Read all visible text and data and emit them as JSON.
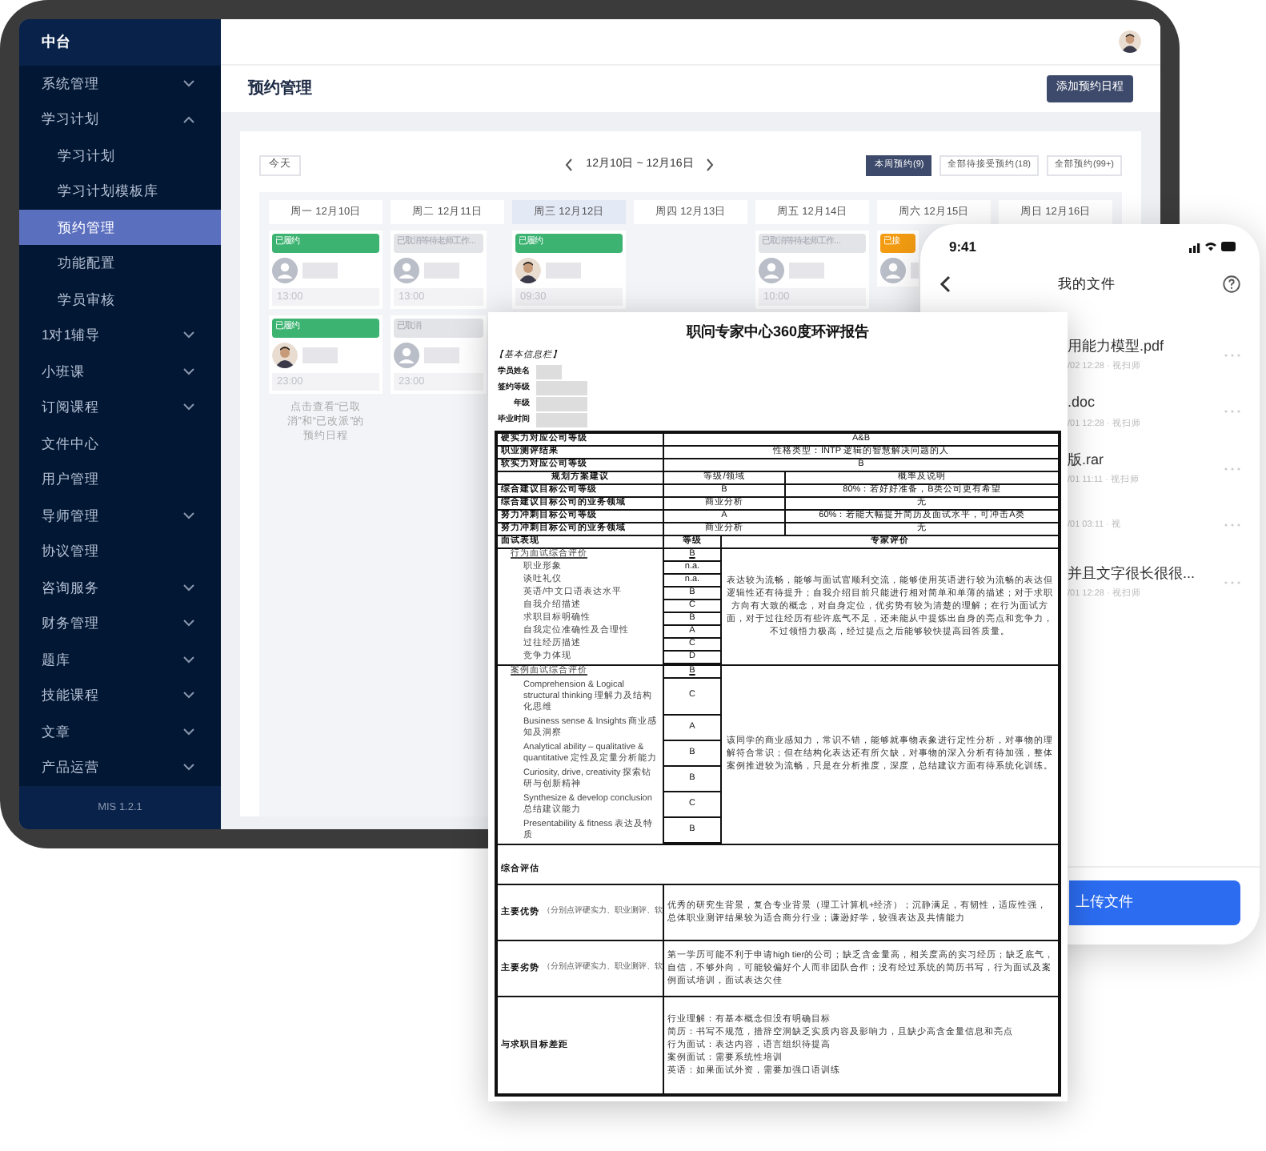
{
  "sidebar": {
    "title": "中台",
    "items": [
      {
        "label": "系统管理",
        "kind": "group",
        "expanded": false
      },
      {
        "label": "学习计划",
        "kind": "group",
        "expanded": true,
        "children": [
          {
            "label": "学习计划",
            "selected": false
          },
          {
            "label": "学习计划模板库",
            "selected": false
          },
          {
            "label": "预约管理",
            "selected": true
          },
          {
            "label": "功能配置",
            "selected": false
          },
          {
            "label": "学员审核",
            "selected": false
          }
        ]
      },
      {
        "label": "1对1辅导",
        "kind": "group",
        "expanded": false
      },
      {
        "label": "小班课",
        "kind": "group",
        "expanded": false
      },
      {
        "label": "订阅课程",
        "kind": "group",
        "expanded": false
      },
      {
        "label": "文件中心",
        "kind": "link"
      },
      {
        "label": "用户管理",
        "kind": "link"
      },
      {
        "label": "导师管理",
        "kind": "group",
        "expanded": false
      },
      {
        "label": "协议管理",
        "kind": "link"
      },
      {
        "label": "咨询服务",
        "kind": "group",
        "expanded": false
      },
      {
        "label": "财务管理",
        "kind": "group",
        "expanded": false
      },
      {
        "label": "题库",
        "kind": "group",
        "expanded": false
      },
      {
        "label": "技能课程",
        "kind": "group",
        "expanded": false
      },
      {
        "label": "文章",
        "kind": "group",
        "expanded": false
      },
      {
        "label": "产品运营",
        "kind": "group",
        "expanded": false
      }
    ],
    "version": "MIS 1.2.1"
  },
  "page": {
    "title": "预约管理",
    "add_button": "添加预约日程"
  },
  "calendar": {
    "today": "今天",
    "range": "12月10日 ~ 12月16日",
    "filters": [
      {
        "label": "本周预约(9)",
        "selected": true
      },
      {
        "label": "全部待接受预约(18)",
        "selected": false
      },
      {
        "label": "全部预约(99+)",
        "selected": false
      }
    ],
    "days": [
      {
        "label": "周一 12月10日",
        "selected": false,
        "events": [
          {
            "kind": "done",
            "status": "已履约",
            "photo": false,
            "time": "13:00"
          },
          {
            "kind": "done",
            "status": "已履约",
            "photo": true,
            "time": "23:00"
          }
        ],
        "hint": "点击查看“已取消”和“已改派”的预约日程"
      },
      {
        "label": "周二 12月11日",
        "selected": false,
        "events": [
          {
            "kind": "cancelled",
            "status": "已取消等待老师工作...",
            "photo": false,
            "time": "13:00"
          },
          {
            "kind": "cancelled",
            "status": "已取消",
            "photo": false,
            "time": "23:00"
          }
        ]
      },
      {
        "label": "周三 12月12日",
        "selected": true,
        "events": [
          {
            "kind": "done",
            "status": "已履约",
            "photo": true,
            "time": "09:30"
          }
        ]
      },
      {
        "label": "周四 12月13日",
        "selected": false
      },
      {
        "label": "周五 12月14日",
        "selected": false,
        "events": [
          {
            "kind": "cancelled",
            "status": "已取消等待老师工作...",
            "photo": false,
            "time": "10:00"
          }
        ]
      },
      {
        "label": "周六 12月15日",
        "selected": false,
        "events": [
          {
            "kind": "accepted",
            "status": "已接",
            "photo": false
          }
        ]
      },
      {
        "label": "周日 12月16日",
        "selected": false
      }
    ]
  },
  "document": {
    "title": "职问专家中心360度环评报告",
    "section": "【基本信息栏】",
    "info_labels": [
      "学员姓名",
      "签约等级",
      "年级",
      "毕业时间"
    ],
    "summary": [
      [
        "硬实力对应公司等级",
        "A&B"
      ],
      [
        "职业测评结果",
        "性格类型：INTP 逻辑的智慧解决问题的人"
      ],
      [
        "软实力对应公司等级",
        "B"
      ]
    ],
    "plan_header": [
      "规划方案建议",
      "等级/领域",
      "概率及说明"
    ],
    "plan_rows": [
      [
        "综合建议目标公司等级",
        "B",
        "80%：若好好准备，B类公司更有希望"
      ],
      [
        "综合建议目标公司的业务领域",
        "商业分析",
        "无"
      ],
      [
        "努力冲刺目标公司等级",
        "A",
        "60%：若能大幅提升简历及面试水平，可冲击A类"
      ],
      [
        "努力冲刺目标公司的业务领域",
        "商业分析",
        "无"
      ]
    ],
    "interview_header": [
      "面试表现",
      "等级",
      "专家评价"
    ],
    "groups": [
      {
        "title": "行为面试综合评价",
        "grade": "B",
        "items": [
          [
            "职业形象",
            "n.a."
          ],
          [
            "谈吐礼仪",
            "n.a."
          ],
          [
            "英语/中文口语表达水平",
            "B"
          ],
          [
            "自我介绍描述",
            "C"
          ],
          [
            "求职目标明确性",
            "B"
          ],
          [
            "自我定位准确性及合理性",
            "A"
          ],
          [
            "过往经历描述",
            "C"
          ],
          [
            "竞争力体现",
            "D"
          ]
        ],
        "comment": "表达较为流畅，能够与面试官顺利交流，能够使用英语进行较为流畅的表达但逻辑性还有待提升；自我介绍目前只能进行相对简单和单薄的描述；对于求职方向有大致的概念，对自身定位，优劣势有较为清楚的理解；在行为面试方面，对于过往经历有些许底气不足，还未能从中提炼出自身的亮点和竞争力，不过领悟力极高，经过提点之后能够较快提高回答质量。"
      },
      {
        "title": "案例面试综合评价",
        "grade": "B",
        "items": [
          [
            "Comprehension & Logical structural thinking 理解力及结构化思维",
            "C"
          ],
          [
            "Business sense & Insights 商业感知及洞察",
            "A"
          ],
          [
            "Analytical ability – qualitative & quantitative 定性及定量分析能力",
            "B"
          ],
          [
            "Curiosity, drive, creativity 探索钻研与创新精神",
            "B"
          ],
          [
            "Synthesize & develop conclusion 总结建议能力",
            "C"
          ],
          [
            "Presentability & fitness 表达及特质",
            "B"
          ]
        ],
        "comment": "该同学的商业感知力，常识不错，能够就事物表象进行定性分析，对事物的理解符合常识；但在结构化表达还有所欠缺，对事物的深入分析有待加强，整体案例推进较为流畅，只是在分析推度，深度，总结建议方面有待系统化训练。"
      }
    ],
    "overall_title": "综合评估",
    "overall": [
      {
        "label": "主要优势",
        "note": "（分别点评硬实力、职业测评、软",
        "text": "优秀的研究生背景，复合专业背景（理工计算机+经济）；沉静满足，有韧性，适应性强，总体职业测评结果较为适合商分行业；谦逊好学，较强表达及共情能力"
      },
      {
        "label": "主要劣势",
        "note": "（分别点评硬实力、职业测评、软",
        "text": "第一学历可能不利于申请high tier的公司；缺乏含金量高，相关度高的实习经历；缺乏底气，自信，不够外向，可能较偏好个人而非团队合作；没有经过系统的简历书写，行为面试及案例面试培训，面试表达欠佳"
      },
      {
        "label": "与求职目标差距",
        "lines": [
          "行业理解：有基本概念但没有明确目标",
          "简历：书写不规范，措辞空洞缺乏实质内容及影响力，且缺少高含金量信息和亮点",
          "行为面试：表达内容，语言组织待提高",
          "案例面试：需要系统性培训",
          "英语：如果面试外资，需要加强口语训练"
        ]
      }
    ]
  },
  "phone": {
    "time": "9:41",
    "title": "我的文件",
    "files": [
      {
        "name": "用能力模型.pdf",
        "meta": "/02 12:28 · 视扫师"
      },
      {
        "name": ".doc",
        "meta": "/01 12:28 · 视扫师"
      },
      {
        "name": "版.rar",
        "meta": "/01 11:11 · 视扫师"
      },
      {
        "meta": "/01 03:11 · 视"
      },
      {
        "name": "并且文字很长很很...",
        "meta": "/01 12:28 · 视扫师"
      }
    ],
    "upload": "上传文件"
  }
}
